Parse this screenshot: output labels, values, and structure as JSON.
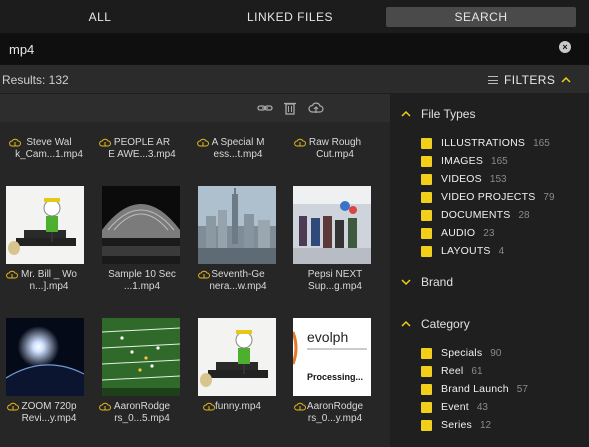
{
  "tabs": [
    {
      "label": "ALL"
    },
    {
      "label": "LINKED FILES"
    },
    {
      "label": "SEARCH"
    }
  ],
  "search": {
    "value": "mp4",
    "clear_icon": "clear-icon"
  },
  "results": {
    "label": "Results: 132"
  },
  "filters_toggle": {
    "label": "FILTERS",
    "icon": "chevron-up-icon"
  },
  "toolbar": {
    "icons": [
      "link-icon",
      "trash-icon",
      "cloud-upload-icon"
    ]
  },
  "grid_items": [
    {
      "label": "Steve Wal\nk_Cam...1.mp4",
      "thumb": "none"
    },
    {
      "label": "PEOPLE AR\nE AWE...3.mp4",
      "thumb": "none"
    },
    {
      "label": "A Special M\ness...t.mp4",
      "thumb": "none"
    },
    {
      "label": "Raw Rough\nCut.mp4",
      "thumb": "none"
    },
    {
      "label": "Mr. Bill _ Wo\nn...].mp4",
      "thumb": "figure-on-bench"
    },
    {
      "label": "Sample 10 Sec\n...1.mp4",
      "thumb": "stage-shell"
    },
    {
      "label": "Seventh-Ge\nnera...w.mp4",
      "thumb": "city-skyline"
    },
    {
      "label": "Pepsi NEXT\nSup...g.mp4",
      "thumb": "crowd-store"
    },
    {
      "label": "ZOOM 720p\nRevi...y.mp4",
      "thumb": "earth-sunrise"
    },
    {
      "label": "AaronRodge\nrs_0...5.mp4",
      "thumb": "football-field"
    },
    {
      "label": "funny.mp4",
      "thumb": "figure-on-bench"
    },
    {
      "label": "AaronRodge\nrs_0...y.mp4",
      "thumb": "evolphin-logo",
      "thumb_text": [
        "evolph",
        "Processing..."
      ]
    }
  ],
  "filters": {
    "sections": [
      {
        "title": "File Types",
        "expanded": true,
        "items": [
          {
            "name": "ILLUSTRATIONS",
            "count": "165"
          },
          {
            "name": "IMAGES",
            "count": "165"
          },
          {
            "name": "VIDEOS",
            "count": "153"
          },
          {
            "name": "VIDEO PROJECTS",
            "count": "79"
          },
          {
            "name": "DOCUMENTS",
            "count": "28"
          },
          {
            "name": "AUDIO",
            "count": "23"
          },
          {
            "name": "LAYOUTS",
            "count": "4"
          }
        ]
      },
      {
        "title": "Brand",
        "expanded": false,
        "items": []
      },
      {
        "title": "Category",
        "expanded": true,
        "items": [
          {
            "name": "Specials",
            "count": "90"
          },
          {
            "name": "Reel",
            "count": "61"
          },
          {
            "name": "Brand Launch",
            "count": "57"
          },
          {
            "name": "Event",
            "count": "43"
          },
          {
            "name": "Series",
            "count": "12"
          }
        ]
      }
    ]
  },
  "colors": {
    "accent": "#f2cf1a",
    "tab_active": "#4a4a4a",
    "panel": "#262626"
  }
}
